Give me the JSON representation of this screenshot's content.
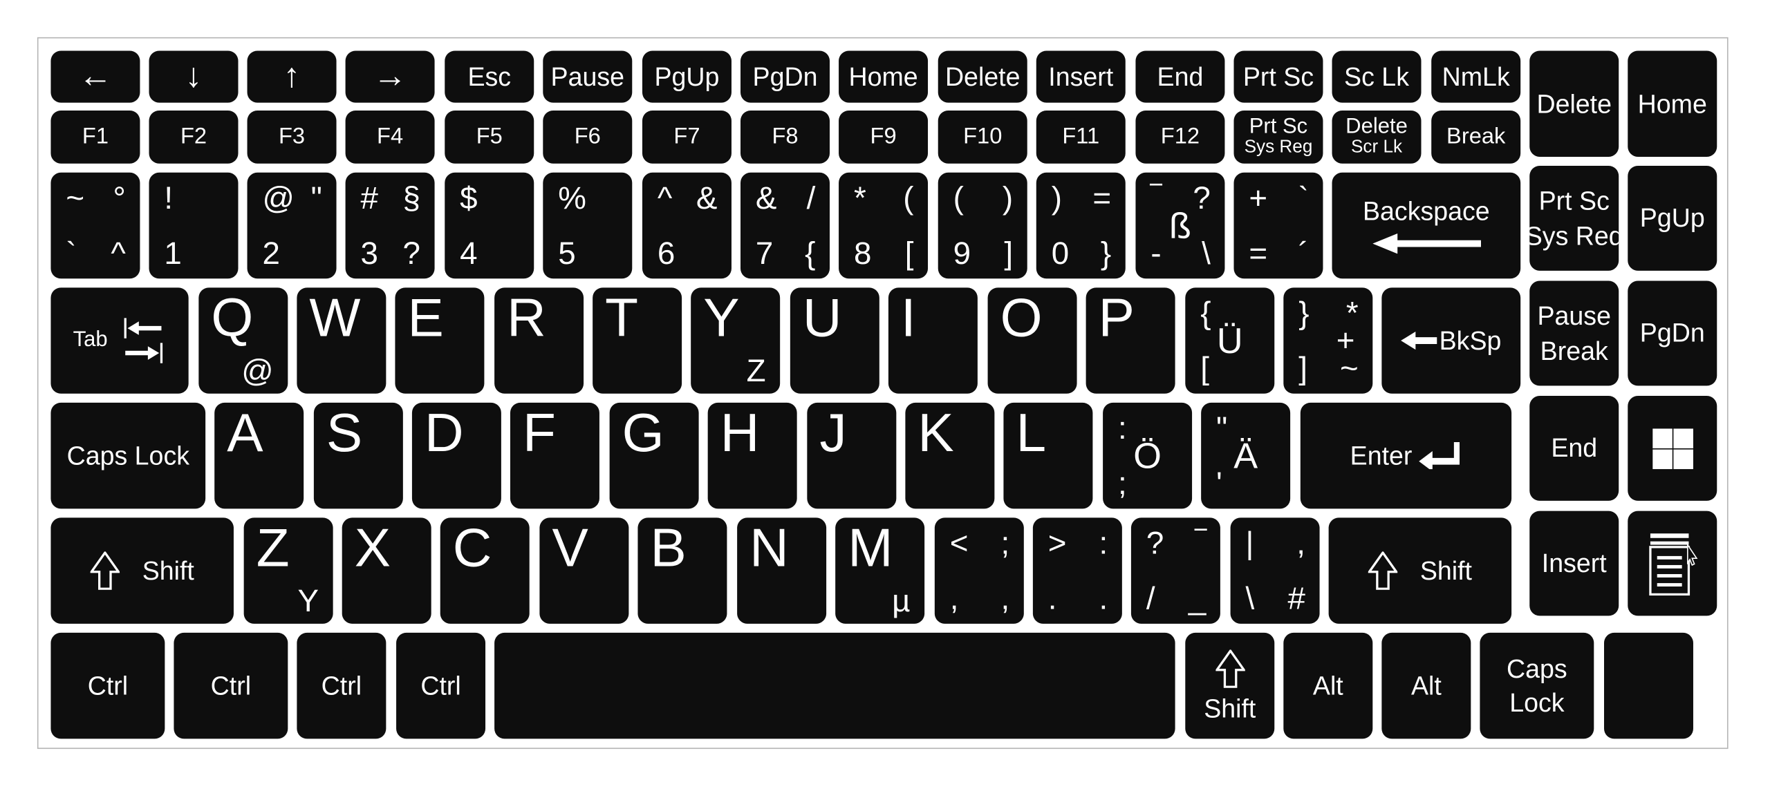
{
  "keyboard": {
    "key_color": "#0e0e0e",
    "legend_color": "#ffffff",
    "rows": [
      {
        "keys": [
          {
            "label": "←",
            "icon": "arrow-left-icon"
          },
          {
            "label": "↓",
            "icon": "arrow-down-icon"
          },
          {
            "label": "↑",
            "icon": "arrow-up-icon"
          },
          {
            "label": "→",
            "icon": "arrow-right-icon"
          },
          {
            "label": "Esc"
          },
          {
            "label": "Pause"
          },
          {
            "label": "PgUp"
          },
          {
            "label": "PgDn"
          },
          {
            "label": "Home"
          },
          {
            "label": "Delete"
          },
          {
            "label": "Insert"
          },
          {
            "label": "End"
          },
          {
            "label": "Prt Sc"
          },
          {
            "label": "Sc Lk"
          },
          {
            "label": "NmLk"
          }
        ]
      },
      {
        "keys": [
          {
            "label": "F1"
          },
          {
            "label": "F2"
          },
          {
            "label": "F3"
          },
          {
            "label": "F4"
          },
          {
            "label": "F5"
          },
          {
            "label": "F6"
          },
          {
            "label": "F7"
          },
          {
            "label": "F8"
          },
          {
            "label": "F9"
          },
          {
            "label": "F10"
          },
          {
            "label": "F11"
          },
          {
            "label": "F12"
          },
          {
            "label": "Prt Sc",
            "label2": "Sys Reg"
          },
          {
            "label": "Delete",
            "label2": "Scr Lk"
          },
          {
            "label": "Break"
          }
        ]
      },
      {
        "keys": [
          {
            "tl": "~",
            "tr": "°",
            "bl": "`",
            "br": "^"
          },
          {
            "tl": "!",
            "bl": "1"
          },
          {
            "tl": "@",
            "tr": "\"",
            "bl": "2"
          },
          {
            "tl": "#",
            "tr": "§",
            "bl": "3",
            "br": "?"
          },
          {
            "tl": "$",
            "bl": "4"
          },
          {
            "tl": "%",
            "bl": "5"
          },
          {
            "tl": "^",
            "tr": "&",
            "bl": "6"
          },
          {
            "tl": "&",
            "tr": "/",
            "bl": "7",
            "br": "{"
          },
          {
            "tl": "*",
            "tr": "(",
            "bl": "8",
            "br": "["
          },
          {
            "tl": "(",
            "tr": ")",
            "bl": "9",
            "br": "]"
          },
          {
            "tl": ")",
            "tr": "=",
            "bl": "0",
            "br": "}"
          },
          {
            "tl": "‾",
            "tr": "?",
            "c": "ß",
            "bl": "-",
            "br": "\\"
          },
          {
            "tl": "+",
            "tr": "`",
            "bl": "=",
            "br": "´"
          },
          {
            "label": "Backspace",
            "icon": "long-left-arrow-icon"
          }
        ]
      },
      {
        "keys": [
          {
            "label": "Tab",
            "icon": "tab-arrows-icon"
          },
          {
            "main": "Q",
            "sub": "@"
          },
          {
            "main": "W"
          },
          {
            "main": "E"
          },
          {
            "main": "R"
          },
          {
            "main": "T"
          },
          {
            "main": "Y",
            "sub": "Z"
          },
          {
            "main": "U"
          },
          {
            "main": "I"
          },
          {
            "main": "O"
          },
          {
            "main": "P"
          },
          {
            "tl": "{",
            "c": "Ü",
            "bl": "["
          },
          {
            "tl": "}",
            "tr": "*",
            "r": "+",
            "bl": "]",
            "br": "~"
          },
          {
            "label": "BkSp",
            "icon": "left-arrow-icon"
          }
        ]
      },
      {
        "keys": [
          {
            "label": "Caps  Lock"
          },
          {
            "main": "A"
          },
          {
            "main": "S"
          },
          {
            "main": "D"
          },
          {
            "main": "F"
          },
          {
            "main": "G"
          },
          {
            "main": "H"
          },
          {
            "main": "J"
          },
          {
            "main": "K"
          },
          {
            "main": "L"
          },
          {
            "tl": ":",
            "c": "Ö",
            "bl": ";"
          },
          {
            "tl": "\"",
            "c": "Ä",
            "bl": "'"
          },
          {
            "label": "Enter",
            "icon": "enter-arrow-icon"
          }
        ]
      },
      {
        "keys": [
          {
            "label": "Shift",
            "icon": "shift-arrow-icon"
          },
          {
            "main": "Z",
            "sub": "Y"
          },
          {
            "main": "X"
          },
          {
            "main": "C"
          },
          {
            "main": "V"
          },
          {
            "main": "B"
          },
          {
            "main": "N"
          },
          {
            "main": "M",
            "sub": "µ"
          },
          {
            "tl": "<",
            "tr": ";",
            "bl": ",",
            "br": ","
          },
          {
            "tl": ">",
            "tr": ":",
            "bl": ".",
            "br": "."
          },
          {
            "tl": "?",
            "tr": "‾",
            "bl": "/",
            "br": "_"
          },
          {
            "tl": "|",
            "tr": ",",
            "bl": "\\",
            "br": "#"
          },
          {
            "label": "Shift",
            "icon": "shift-arrow-icon"
          }
        ]
      },
      {
        "keys": [
          {
            "label": "Ctrl"
          },
          {
            "label": "Ctrl"
          },
          {
            "label": "Ctrl"
          },
          {
            "label": "Ctrl"
          },
          {
            "label": "",
            "name": "space"
          },
          {
            "label": "Shift",
            "icon": "shift-arrow-stacked-icon"
          },
          {
            "label": "Alt"
          },
          {
            "label": "Alt"
          },
          {
            "label": "Caps",
            "label2": "Lock"
          },
          {
            "label": "",
            "name": "blank"
          }
        ]
      }
    ],
    "nav_cluster": [
      {
        "label": "Delete"
      },
      {
        "label": "Home"
      },
      {
        "label": "Prt Sc",
        "label2": "Sys Req"
      },
      {
        "label": "PgUp"
      },
      {
        "label": "Pause",
        "label2": "Break"
      },
      {
        "label": "PgDn"
      },
      {
        "label": "End"
      },
      {
        "label": "",
        "icon": "windows-icon"
      },
      {
        "label": "Insert"
      },
      {
        "label": "",
        "icon": "menu-icon"
      }
    ]
  }
}
